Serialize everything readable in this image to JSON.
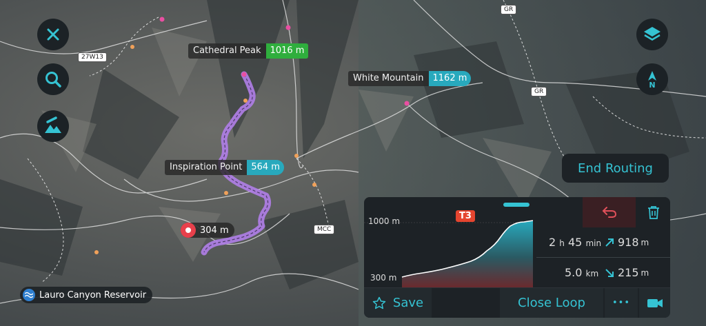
{
  "map": {
    "peaks": [
      {
        "name": "Cathedral Peak",
        "elevation": "1016 m",
        "color": "#2fae3d"
      },
      {
        "name": "White Mountain",
        "elevation": "1162 m",
        "color": "#28a9bd"
      },
      {
        "name": "Inspiration Point",
        "elevation": "564 m",
        "color": "#28a9bd"
      }
    ],
    "start_marker": "304 m",
    "road_labels": [
      "27W13",
      "GR",
      "GR",
      "MCC"
    ],
    "reservoir": "Lauro Canyon Reservoir",
    "route_color": "#b07ee8"
  },
  "buttons": {
    "close": "close-icon",
    "search": "search-icon",
    "terrain": "terrain-icon",
    "layers": "layers-icon",
    "compass": "N",
    "end_routing": "End Routing"
  },
  "panel": {
    "difficulty": "T3",
    "elev_max": "1000 m",
    "elev_min": "300 m",
    "duration_h": "2",
    "duration_h_unit": "h",
    "duration_m": "45",
    "duration_m_unit": "min",
    "ascent": "918",
    "ascent_unit": "m",
    "distance": "5.0",
    "distance_unit": "km",
    "descent": "215",
    "descent_unit": "m",
    "save": "Save",
    "close_loop": "Close Loop",
    "more": "•••",
    "accent": "#35c3d3",
    "undo_color": "#e0505a"
  }
}
